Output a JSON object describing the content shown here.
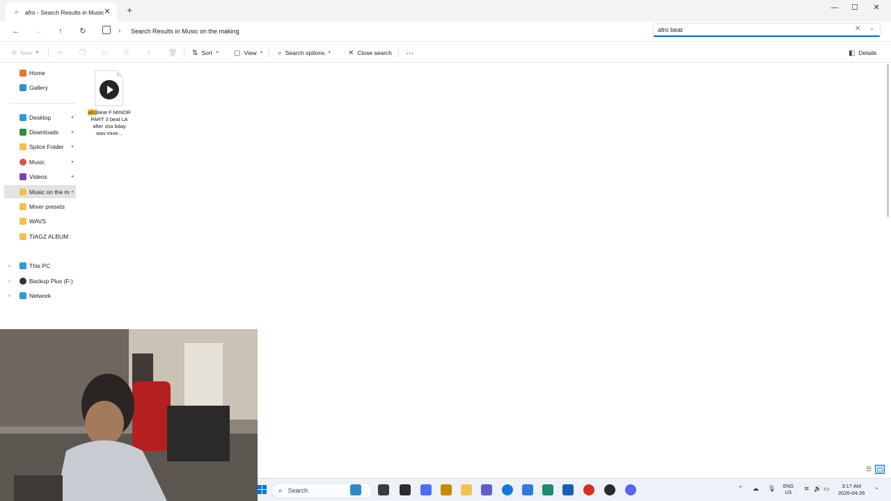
{
  "tab": {
    "title": "afro - Search Results in Music",
    "close": "✕",
    "new_tab": "+"
  },
  "window_controls": {
    "minimize": "—",
    "maximize": "☐",
    "close": "✕"
  },
  "nav": {
    "back": "←",
    "forward": "→",
    "up": "↑",
    "refresh": "↻",
    "breadcrumb_sep": "›",
    "breadcrumb": "Search Results in Music on the making"
  },
  "search": {
    "value": "afro beat",
    "clear": "✕",
    "icon": "⌕"
  },
  "command_bar": {
    "new": "New",
    "sort": "Sort",
    "view": "View",
    "search_options": "Search options",
    "close_search": "Close search",
    "more": "···",
    "details": "Details"
  },
  "sidebar": {
    "items": [
      {
        "label": "Home",
        "icon": "home-icon",
        "color": "#e8752a",
        "pinned": false
      },
      {
        "label": "Gallery",
        "icon": "gallery-icon",
        "color": "#2b8fd6",
        "pinned": false
      },
      {
        "label": "Desktop",
        "icon": "desktop-icon",
        "color": "#2e9bd6",
        "pinned": true
      },
      {
        "label": "Downloads",
        "icon": "downloads-icon",
        "color": "#2f8f3a",
        "pinned": true
      },
      {
        "label": "Splice Folder",
        "icon": "folder-icon",
        "color": "#f2c14e",
        "pinned": true
      },
      {
        "label": "Music",
        "icon": "music-icon",
        "color": "#d9534f",
        "pinned": true
      },
      {
        "label": "Videos",
        "icon": "videos-icon",
        "color": "#7b3fbf",
        "pinned": true
      },
      {
        "label": "Music on the m",
        "icon": "folder-icon",
        "color": "#f2c14e",
        "pinned": true,
        "selected": true
      },
      {
        "label": "Mixer presets",
        "icon": "folder-icon",
        "color": "#f2c14e",
        "pinned": false
      },
      {
        "label": "WAVS",
        "icon": "folder-icon",
        "color": "#f2c14e",
        "pinned": false
      },
      {
        "label": "TIAGZ ALBUM 1",
        "icon": "folder-icon",
        "color": "#f2c14e",
        "pinned": false
      },
      {
        "label": "This PC",
        "icon": "pc-icon",
        "color": "#2e9bd6",
        "expandable": true
      },
      {
        "label": "Backup Plus  (F:)",
        "icon": "drive-icon",
        "color": "#333333",
        "expandable": true
      },
      {
        "label": "Network",
        "icon": "network-icon",
        "color": "#2e9bd6",
        "expandable": true
      }
    ],
    "pin_glyph": "✦",
    "expand_glyph": "›"
  },
  "results": [
    {
      "highlight": "afro",
      "name_rest": "beat F MINOR PART 3 beat LA after sha bday wav mixe..."
    }
  ],
  "taskbar": {
    "search_label": "Search",
    "language": "ENG",
    "region": "US",
    "time": "3:17 AM",
    "date": "2026-04-26"
  }
}
